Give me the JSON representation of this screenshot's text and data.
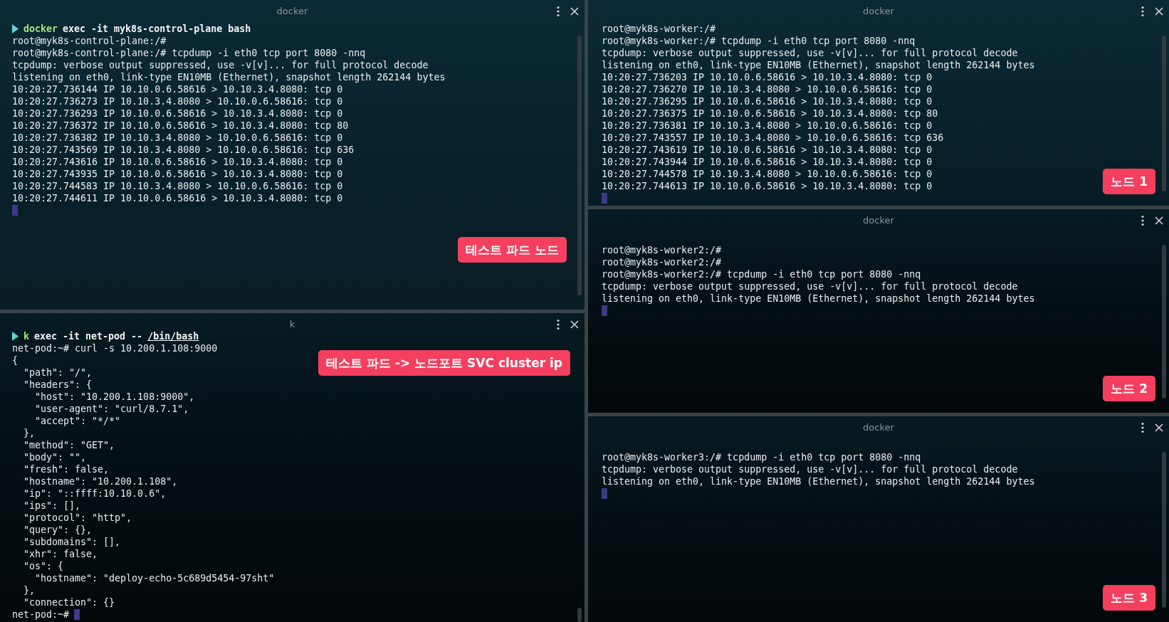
{
  "panes": [
    {
      "title": "docker",
      "cursor": true,
      "note": "테스트 파드 노드",
      "lines": [
        {
          "kind": "command",
          "program": "docker",
          "args": "exec -it myk8s-control-plane bash"
        },
        {
          "kind": "text",
          "text": "root@myk8s-control-plane:/#"
        },
        {
          "kind": "text",
          "text": "root@myk8s-control-plane:/# tcpdump -i eth0 tcp port 8080 -nnq"
        },
        {
          "kind": "text",
          "text": "tcpdump: verbose output suppressed, use -v[v]... for full protocol decode"
        },
        {
          "kind": "text",
          "text": "listening on eth0, link-type EN10MB (Ethernet), snapshot length 262144 bytes"
        },
        {
          "kind": "text",
          "text": "10:20:27.736144 IP 10.10.0.6.58616 > 10.10.3.4.8080: tcp 0"
        },
        {
          "kind": "text",
          "text": "10:20:27.736273 IP 10.10.3.4.8080 > 10.10.0.6.58616: tcp 0"
        },
        {
          "kind": "text",
          "text": "10:20:27.736293 IP 10.10.0.6.58616 > 10.10.3.4.8080: tcp 0"
        },
        {
          "kind": "text",
          "text": "10:20:27.736372 IP 10.10.0.6.58616 > 10.10.3.4.8080: tcp 80"
        },
        {
          "kind": "text",
          "text": "10:20:27.736382 IP 10.10.3.4.8080 > 10.10.0.6.58616: tcp 0"
        },
        {
          "kind": "text",
          "text": "10:20:27.743569 IP 10.10.3.4.8080 > 10.10.0.6.58616: tcp 636"
        },
        {
          "kind": "text",
          "text": "10:20:27.743616 IP 10.10.0.6.58616 > 10.10.3.4.8080: tcp 0"
        },
        {
          "kind": "text",
          "text": "10:20:27.743935 IP 10.10.0.6.58616 > 10.10.3.4.8080: tcp 0"
        },
        {
          "kind": "text",
          "text": "10:20:27.744583 IP 10.10.3.4.8080 > 10.10.0.6.58616: tcp 0"
        },
        {
          "kind": "text",
          "text": "10:20:27.744611 IP 10.10.0.6.58616 > 10.10.3.4.8080: tcp 0"
        }
      ]
    },
    {
      "title": "k",
      "cursor": true,
      "note": "테스트 파드 -> 노드포트 SVC cluster ip",
      "lines": [
        {
          "kind": "command",
          "program": "k",
          "args": "exec -it net-pod --",
          "path": "/bin/bash"
        },
        {
          "kind": "text",
          "text": "net-pod:~# curl -s 10.200.1.108:9000"
        },
        {
          "kind": "text",
          "text": "{"
        },
        {
          "kind": "text",
          "text": "  \"path\": \"/\","
        },
        {
          "kind": "text",
          "text": "  \"headers\": {"
        },
        {
          "kind": "text",
          "text": "    \"host\": \"10.200.1.108:9000\","
        },
        {
          "kind": "text",
          "text": "    \"user-agent\": \"curl/8.7.1\","
        },
        {
          "kind": "text",
          "text": "    \"accept\": \"*/*\""
        },
        {
          "kind": "text",
          "text": "  },"
        },
        {
          "kind": "text",
          "text": "  \"method\": \"GET\","
        },
        {
          "kind": "text",
          "text": "  \"body\": \"\","
        },
        {
          "kind": "text",
          "text": "  \"fresh\": false,"
        },
        {
          "kind": "text",
          "text": "  \"hostname\": \"10.200.1.108\","
        },
        {
          "kind": "text",
          "text": "  \"ip\": \"::ffff:10.10.0.6\","
        },
        {
          "kind": "text",
          "text": "  \"ips\": [],"
        },
        {
          "kind": "text",
          "text": "  \"protocol\": \"http\","
        },
        {
          "kind": "text",
          "text": "  \"query\": {},"
        },
        {
          "kind": "text",
          "text": "  \"subdomains\": [],"
        },
        {
          "kind": "text",
          "text": "  \"xhr\": false,"
        },
        {
          "kind": "text",
          "text": "  \"os\": {"
        },
        {
          "kind": "text",
          "text": "    \"hostname\": \"deploy-echo-5c689d5454-97sht\""
        },
        {
          "kind": "text",
          "text": "  },"
        },
        {
          "kind": "text",
          "text": "  \"connection\": {}"
        },
        {
          "kind": "prompt",
          "text": "net-pod:~#"
        }
      ]
    },
    {
      "title": "docker",
      "cursor": true,
      "note": "노드 1",
      "lines": [
        {
          "kind": "text",
          "text": "root@myk8s-worker:/#"
        },
        {
          "kind": "text",
          "text": "root@myk8s-worker:/# tcpdump -i eth0 tcp port 8080 -nnq"
        },
        {
          "kind": "text",
          "text": "tcpdump: verbose output suppressed, use -v[v]... for full protocol decode"
        },
        {
          "kind": "text",
          "text": "listening on eth0, link-type EN10MB (Ethernet), snapshot length 262144 bytes"
        },
        {
          "kind": "text",
          "text": "10:20:27.736203 IP 10.10.0.6.58616 > 10.10.3.4.8080: tcp 0"
        },
        {
          "kind": "text",
          "text": "10:20:27.736270 IP 10.10.3.4.8080 > 10.10.0.6.58616: tcp 0"
        },
        {
          "kind": "text",
          "text": "10:20:27.736295 IP 10.10.0.6.58616 > 10.10.3.4.8080: tcp 0"
        },
        {
          "kind": "text",
          "text": "10:20:27.736375 IP 10.10.0.6.58616 > 10.10.3.4.8080: tcp 80"
        },
        {
          "kind": "text",
          "text": "10:20:27.736381 IP 10.10.3.4.8080 > 10.10.0.6.58616: tcp 0"
        },
        {
          "kind": "text",
          "text": "10:20:27.743557 IP 10.10.3.4.8080 > 10.10.0.6.58616: tcp 636"
        },
        {
          "kind": "text",
          "text": "10:20:27.743619 IP 10.10.0.6.58616 > 10.10.3.4.8080: tcp 0"
        },
        {
          "kind": "text",
          "text": "10:20:27.743944 IP 10.10.0.6.58616 > 10.10.3.4.8080: tcp 0"
        },
        {
          "kind": "text",
          "text": "10:20:27.744578 IP 10.10.3.4.8080 > 10.10.0.6.58616: tcp 0"
        },
        {
          "kind": "text",
          "text": "10:20:27.744613 IP 10.10.0.6.58616 > 10.10.3.4.8080: tcp 0"
        }
      ]
    },
    {
      "title": "docker",
      "cursor": true,
      "note": "노드 2",
      "lines": [
        {
          "kind": "text",
          "text": "root@myk8s-worker2:/#"
        },
        {
          "kind": "text",
          "text": "root@myk8s-worker2:/#"
        },
        {
          "kind": "text",
          "text": "root@myk8s-worker2:/# tcpdump -i eth0 tcp port 8080 -nnq"
        },
        {
          "kind": "text",
          "text": "tcpdump: verbose output suppressed, use -v[v]... for full protocol decode"
        },
        {
          "kind": "text",
          "text": "listening on eth0, link-type EN10MB (Ethernet), snapshot length 262144 bytes"
        }
      ]
    },
    {
      "title": "docker",
      "cursor": true,
      "note": "노드 3",
      "lines": [
        {
          "kind": "text",
          "text": "root@myk8s-worker3:/# tcpdump -i eth0 tcp port 8080 -nnq"
        },
        {
          "kind": "text",
          "text": "tcpdump: verbose output suppressed, use -v[v]... for full protocol decode"
        },
        {
          "kind": "text",
          "text": "listening on eth0, link-type EN10MB (Ethernet), snapshot length 262144 bytes"
        }
      ]
    }
  ]
}
